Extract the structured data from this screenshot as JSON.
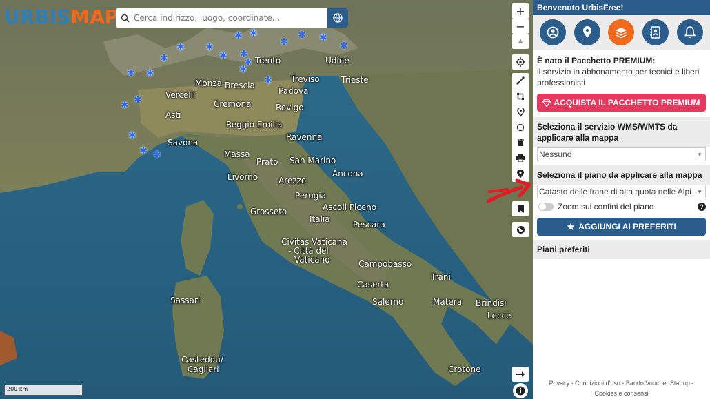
{
  "logo": {
    "part1": "URBIS",
    "part2": "MAP"
  },
  "search": {
    "placeholder": "Cerca indirizzo, luogo, coordinate..."
  },
  "map": {
    "cities": [
      {
        "name": "Trento"
      },
      {
        "name": "Udine"
      },
      {
        "name": "Treviso"
      },
      {
        "name": "Trieste"
      },
      {
        "name": "Monza"
      },
      {
        "name": "Brescia"
      },
      {
        "name": "Padova"
      },
      {
        "name": "Vercelli"
      },
      {
        "name": "Cremona"
      },
      {
        "name": "Rovigo"
      },
      {
        "name": "Asti"
      },
      {
        "name": "Reggio Emilia"
      },
      {
        "name": "Ravenna"
      },
      {
        "name": "Savona"
      },
      {
        "name": "Massa"
      },
      {
        "name": "Prato"
      },
      {
        "name": "San Marino"
      },
      {
        "name": "Livorno"
      },
      {
        "name": "Arezzo"
      },
      {
        "name": "Ancona"
      },
      {
        "name": "Perugia"
      },
      {
        "name": "Grosseto"
      },
      {
        "name": "Ascoli Piceno"
      },
      {
        "name": "Italia"
      },
      {
        "name": "Pescara"
      },
      {
        "name": "Civitas Vaticana"
      },
      {
        "name": "- Città del"
      },
      {
        "name": "Vaticano"
      },
      {
        "name": "Campobasso"
      },
      {
        "name": "Trani"
      },
      {
        "name": "Sassari"
      },
      {
        "name": "Caserta"
      },
      {
        "name": "Matera"
      },
      {
        "name": "Brindisi"
      },
      {
        "name": "Salerno"
      },
      {
        "name": "Lecce"
      },
      {
        "name": "Casteddu/"
      },
      {
        "name": "Cagliari"
      },
      {
        "name": "Crotone"
      }
    ],
    "scale_label": "200 km",
    "marker_icon": "snowflake-icon",
    "marker_color": "#2f6bff"
  },
  "toolbar": {
    "zoom_in": "+",
    "zoom_out": "−",
    "compass": "▲",
    "tools": [
      "locate-icon",
      "measure-line-icon",
      "measure-area-icon",
      "place-pin-icon",
      "circle-icon",
      "trash-icon",
      "print-icon",
      "marker-icon"
    ]
  },
  "panel": {
    "welcome": "Benvenuto UrbisFree!",
    "icons": [
      "user-icon",
      "location-icon",
      "layers-icon",
      "contacts-icon",
      "bell-icon"
    ],
    "premium_title": "È nato il Pacchetto PREMIUM:",
    "premium_desc": "il servizio in abbonamento per tecnici e liberi professionisti",
    "buy_label": "ACQUISTA IL PACCHETTO PREMIUM",
    "wms_header": "Seleziona il servizio WMS/WMTS da applicare alla mappa",
    "wms_value": "Nessuno",
    "plan_header": "Seleziona il piano da applicare alla mappa",
    "plan_value": "Catasto delle frane di alta quota nelle Alpi",
    "zoom_label": "Zoom sui confini del piano",
    "fav_label": "AGGIUNGI AI PREFERITI",
    "fav_header": "Piani preferiti",
    "footer_line1": "Privacy - Condizioni d'uso - Bando Voucher Startup -",
    "footer_line2": "Cookies e consensi"
  },
  "colors": {
    "brand_blue": "#2a5d8c",
    "brand_orange": "#f06a1e",
    "premium_pink": "#e33a5e"
  }
}
